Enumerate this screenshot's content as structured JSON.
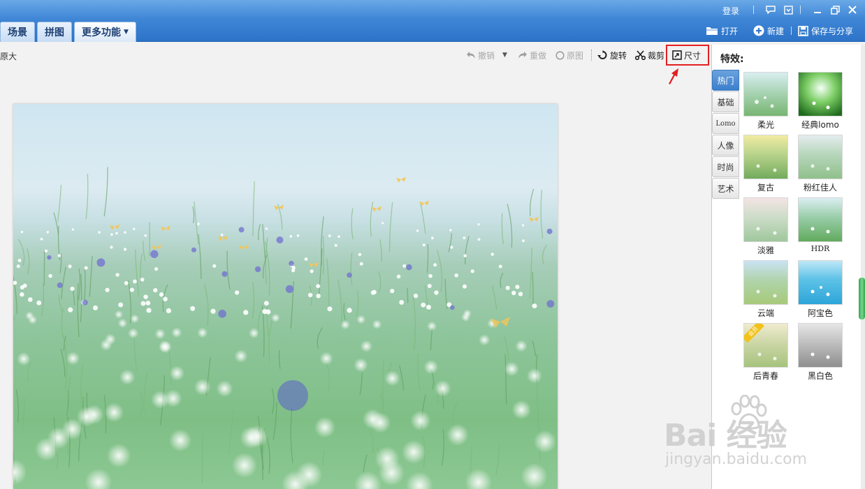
{
  "window": {
    "login_label": "登录"
  },
  "tabs": [
    {
      "label": "场景"
    },
    {
      "label": "拼图"
    },
    {
      "label": "更多功能"
    }
  ],
  "actions": {
    "open_label": "打开",
    "new_label": "新建",
    "save_share_label": "保存与分享"
  },
  "toolbar": {
    "original_size_label": "原大",
    "undo_label": "撤销",
    "redo_label": "重做",
    "original_label": "原图",
    "rotate_label": "旋转",
    "crop_label": "裁剪",
    "size_label": "尺寸",
    "highlight_color": "#e41f1f"
  },
  "effects_panel": {
    "title": "特效:",
    "categories": [
      {
        "label": "热门",
        "active": true
      },
      {
        "label": "基础"
      },
      {
        "label": "Lomo"
      },
      {
        "label": "人像"
      },
      {
        "label": "时尚"
      },
      {
        "label": "艺术"
      }
    ],
    "effects": [
      {
        "label": "柔光"
      },
      {
        "label": "经典lomo"
      },
      {
        "label": "复古"
      },
      {
        "label": "粉红佳人"
      },
      {
        "label": "淡雅"
      },
      {
        "label": "HDR"
      },
      {
        "label": "云端"
      },
      {
        "label": "阿宝色"
      },
      {
        "label": "后青春",
        "badge": "会员"
      },
      {
        "label": "黑白色"
      }
    ]
  },
  "watermark": {
    "brand": "Bai 经验",
    "url": "jingyan.baidu.com"
  },
  "colors": {
    "titlebar": "#3f86d6",
    "accent_blue": "#3b7fcc",
    "scroll_green": "#2ea84b"
  }
}
